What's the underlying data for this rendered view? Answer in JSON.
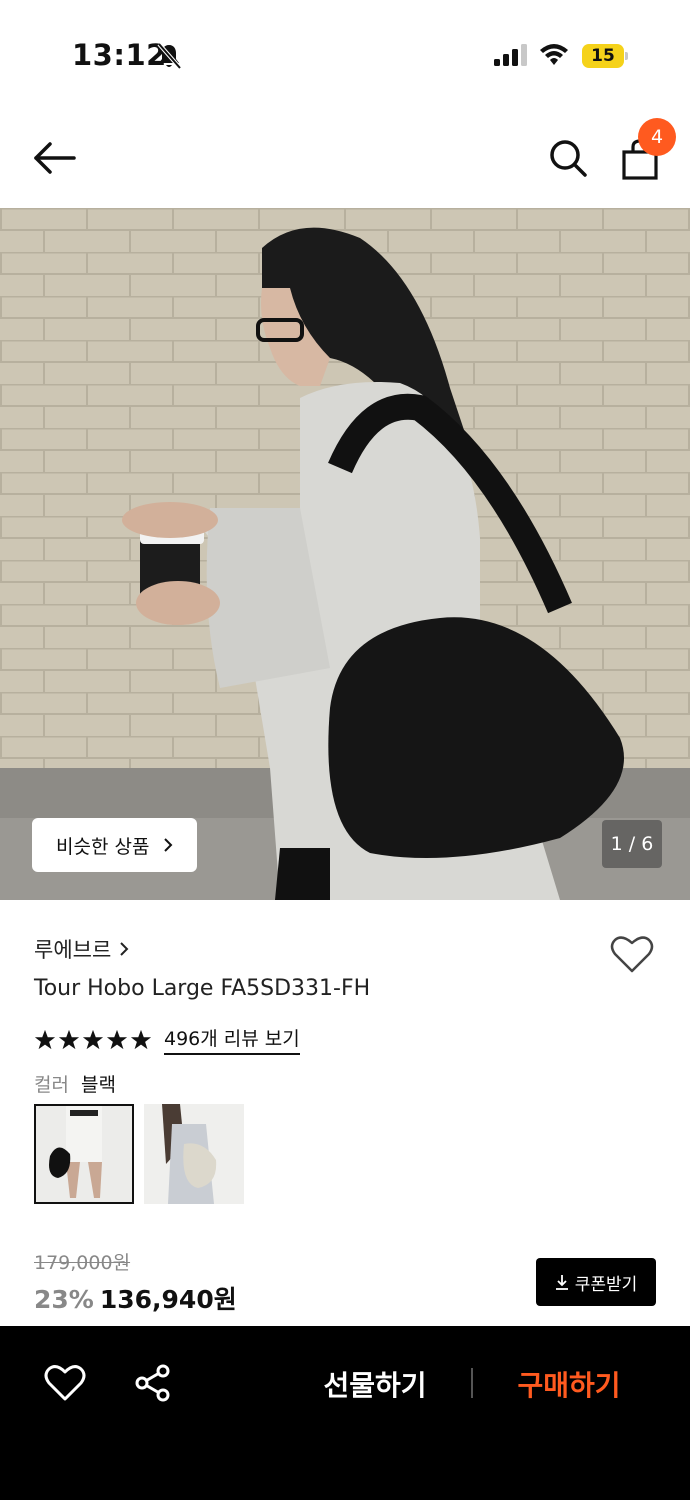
{
  "status_bar": {
    "time": "13:12",
    "battery": "15"
  },
  "nav": {
    "cart_count": "4"
  },
  "hero": {
    "similar_label": "비슷한 상품",
    "page_indicator": "1 / 6"
  },
  "product": {
    "brand": "루에브르",
    "name": "Tour Hobo Large FA5SD331-FH",
    "rating_stars": 5,
    "review_link": "496개 리뷰 보기",
    "color_label": "컬러",
    "color_value": "블랙",
    "original_price": "179,000원",
    "discount": "23%",
    "price": "136,940원",
    "coupon_label": "쿠폰받기"
  },
  "bottom_bar": {
    "gift_label": "선물하기",
    "buy_label": "구매하기"
  },
  "colors": {
    "accent": "#ff5a1f",
    "battery": "#f5d21a"
  }
}
